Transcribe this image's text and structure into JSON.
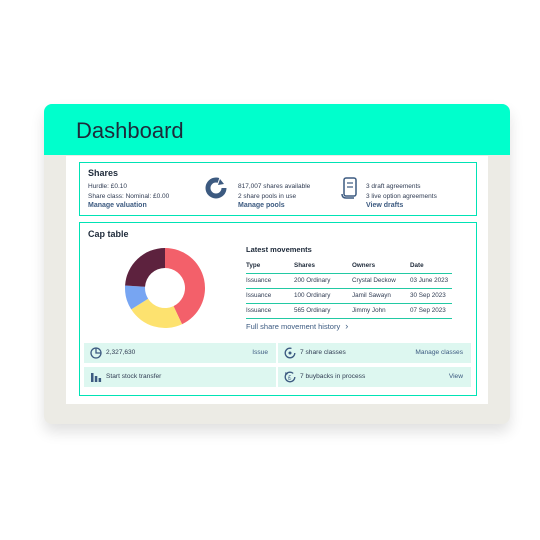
{
  "header": {
    "title": "Dashboard"
  },
  "shares": {
    "title": "Shares",
    "hurdle": "Hurdle: £0.10",
    "share_class": "Share class: Nominal: £0.00",
    "manage_valuation": "Manage valuation",
    "available": "817,007 shares available",
    "pools_in_use": "2 share pools in use",
    "manage_pools": "Manage pools",
    "draft_agreements": "3 draft agreements",
    "live_option_agreements": "3 live option agreements",
    "view_drafts": "View drafts"
  },
  "cap_table": {
    "title": "Cap table",
    "latest_movements": "Latest movements",
    "columns": [
      "Type",
      "Shares",
      "Owners",
      "Date"
    ],
    "rows": [
      [
        "Issuance",
        "200 Ordinary",
        "Crystal Deckow",
        "03 June 2023"
      ],
      [
        "Issuance",
        "100 Ordinary",
        "Jamil Sawayn",
        "30 Sep 2023"
      ],
      [
        "Issuance",
        "565 Ordinary",
        "Jimmy John",
        "07 Sep 2023"
      ]
    ],
    "history_link": "Full share movement history",
    "tiles": {
      "total": "2,327,630",
      "issue": "Issue",
      "share_classes": "7 share classes",
      "manage_classes": "Manage classes",
      "stock_transfer": "Start stock transfer",
      "buybacks": "7 buybacks in process",
      "view": "View"
    }
  },
  "chart_data": {
    "type": "pie",
    "slices": [
      {
        "value": 0.43,
        "color": "#f3606a"
      },
      {
        "value": 0.23,
        "color": "#fde26f"
      },
      {
        "value": 0.1,
        "color": "#77a5f2"
      },
      {
        "value": 0.24,
        "color": "#5d223e"
      }
    ]
  }
}
